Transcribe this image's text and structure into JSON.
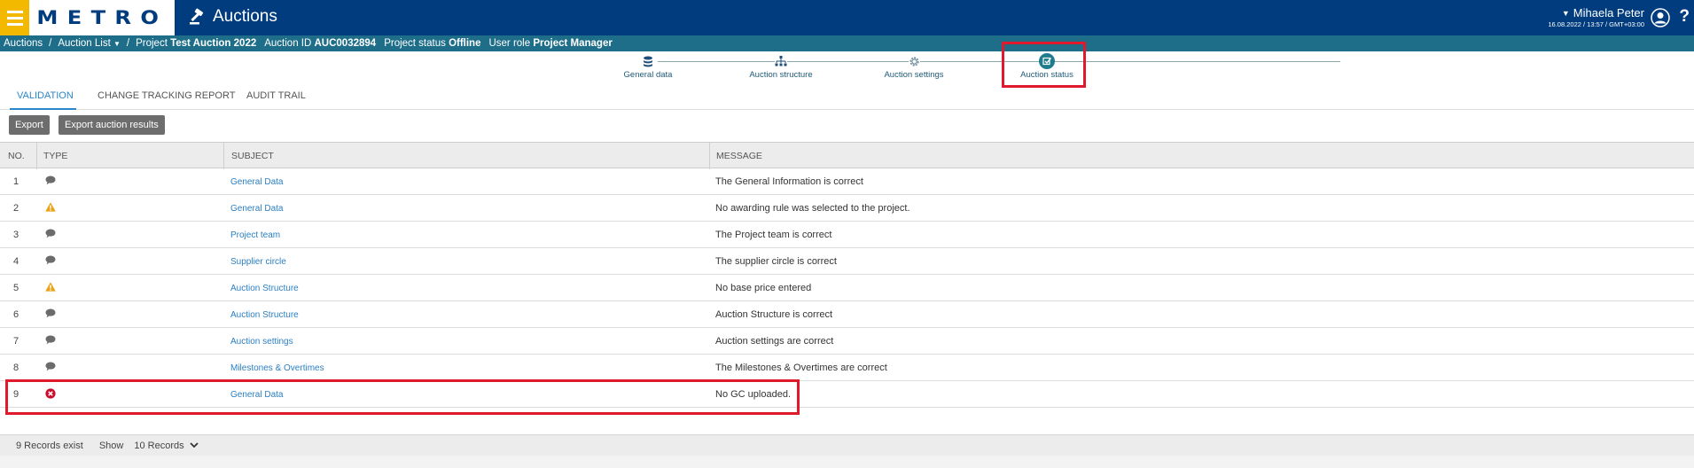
{
  "header": {
    "logo_text": "METRO",
    "app_title": "Auctions",
    "user_name": "Mihaela Peter",
    "user_meta": "16.08.2022 / 13:57 / GMT+03:00",
    "help": "?"
  },
  "breadcrumb": {
    "root": "Auctions",
    "list": "Auction List",
    "project_label": "Project",
    "project_value": "Test Auction 2022",
    "auction_id_label": "Auction ID",
    "auction_id_value": "AUC0032894",
    "status_label": "Project status",
    "status_value": "Offline",
    "role_label": "User role",
    "role_value": "Project Manager"
  },
  "stepper": {
    "steps": [
      {
        "label": "General data",
        "icon": "database-icon"
      },
      {
        "label": "Auction structure",
        "icon": "hierarchy-icon"
      },
      {
        "label": "Auction settings",
        "icon": "gear-icon"
      },
      {
        "label": "Auction status",
        "icon": "check-square-icon"
      }
    ],
    "active_index": 3
  },
  "tabs": [
    {
      "label": "VALIDATION",
      "active": true
    },
    {
      "label": "CHANGE TRACKING REPORT",
      "active": false
    },
    {
      "label": "AUDIT TRAIL",
      "active": false
    }
  ],
  "buttons": {
    "export": "Export",
    "export_results": "Export auction results"
  },
  "table": {
    "columns": [
      "NO.",
      "TYPE",
      "SUBJECT",
      "MESSAGE"
    ],
    "rows": [
      {
        "no": "1",
        "type": "info",
        "subject": "General Data",
        "message": "The General Information is correct"
      },
      {
        "no": "2",
        "type": "warning",
        "subject": "General Data",
        "message": "No awarding rule was selected to the project."
      },
      {
        "no": "3",
        "type": "info",
        "subject": "Project team",
        "message": "The Project team is correct"
      },
      {
        "no": "4",
        "type": "info",
        "subject": "Supplier circle",
        "message": "The supplier circle is correct"
      },
      {
        "no": "5",
        "type": "warning",
        "subject": "Auction Structure",
        "message": "No base price entered"
      },
      {
        "no": "6",
        "type": "info",
        "subject": "Auction Structure",
        "message": "Auction Structure is correct"
      },
      {
        "no": "7",
        "type": "info",
        "subject": "Auction settings",
        "message": "Auction settings are correct"
      },
      {
        "no": "8",
        "type": "info",
        "subject": "Milestones & Overtimes",
        "message": "The Milestones & Overtimes are correct"
      },
      {
        "no": "9",
        "type": "error",
        "subject": "General Data",
        "message": "No GC uploaded."
      }
    ]
  },
  "footer": {
    "records": "9 Records exist",
    "show": "Show",
    "page_size": "10 Records"
  },
  "colors": {
    "header_bg": "#003c7e",
    "breadcrumb_bg": "#1e6e89",
    "accent": "#2a86c9",
    "highlight": "#e0192c",
    "warning": "#e8a317",
    "error": "#c8102e"
  }
}
